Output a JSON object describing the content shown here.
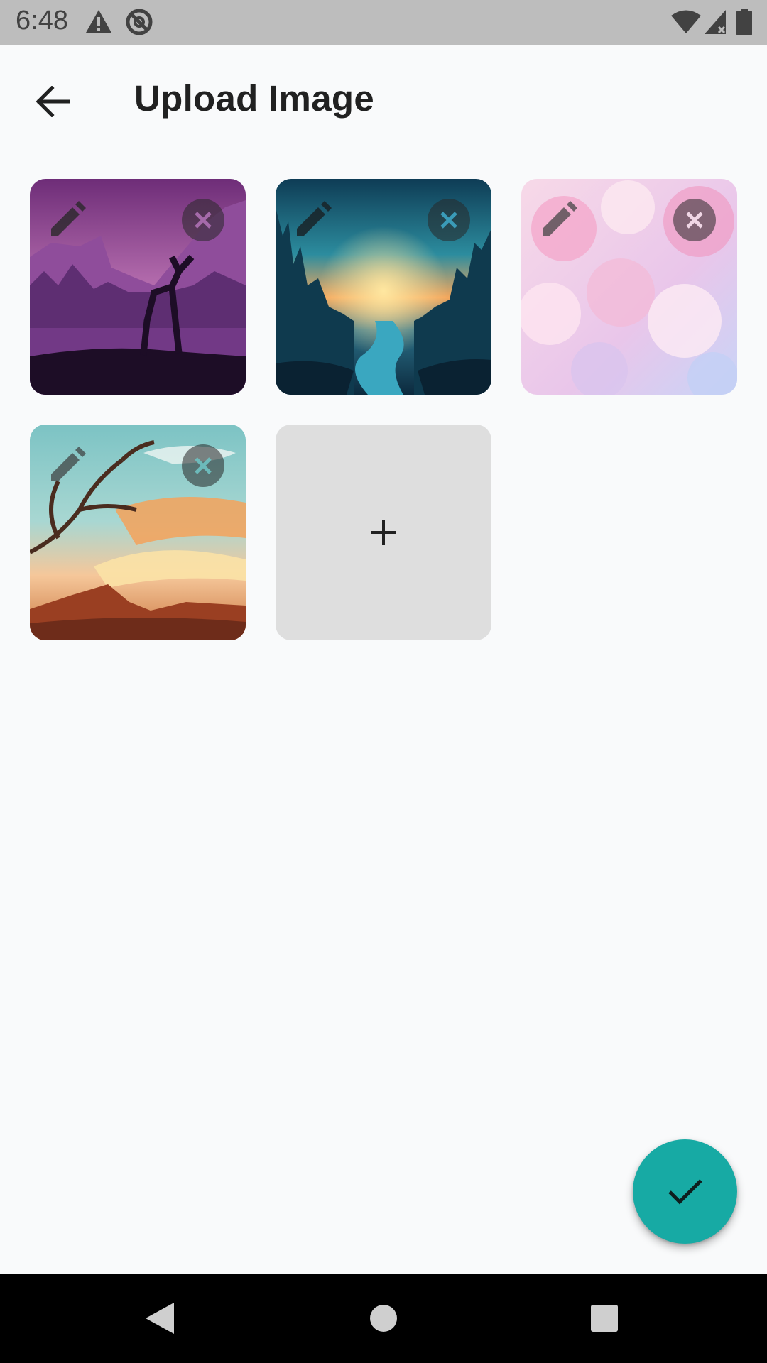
{
  "status_bar": {
    "time": "6:48",
    "icons": [
      "warning-icon",
      "sync-disabled-icon",
      "wifi-icon",
      "signal-icon",
      "battery-icon"
    ]
  },
  "app_bar": {
    "back_icon": "arrow-back-icon",
    "title": "Upload Image"
  },
  "images": [
    {
      "name": "purple-deer-landscape",
      "edit_icon": "pencil-icon",
      "remove_icon": "close-circle-icon"
    },
    {
      "name": "forest-river-sunset",
      "edit_icon": "pencil-icon",
      "remove_icon": "close-circle-icon"
    },
    {
      "name": "pink-cherry-blossoms",
      "edit_icon": "pencil-icon",
      "remove_icon": "close-circle-icon"
    },
    {
      "name": "tree-sky-mountains",
      "edit_icon": "pencil-icon",
      "remove_icon": "close-circle-icon"
    }
  ],
  "add_tile": {
    "icon": "plus-icon",
    "symbol": "+"
  },
  "fab": {
    "icon": "check-icon",
    "color": "#17aaa4"
  },
  "nav_bar": {
    "icons": [
      "nav-back-icon",
      "nav-home-icon",
      "nav-recents-icon"
    ]
  },
  "colors": {
    "background": "#f9fafb",
    "status_bar": "#bdbdbd",
    "accent": "#17aaa4",
    "add_tile": "#dedede"
  }
}
